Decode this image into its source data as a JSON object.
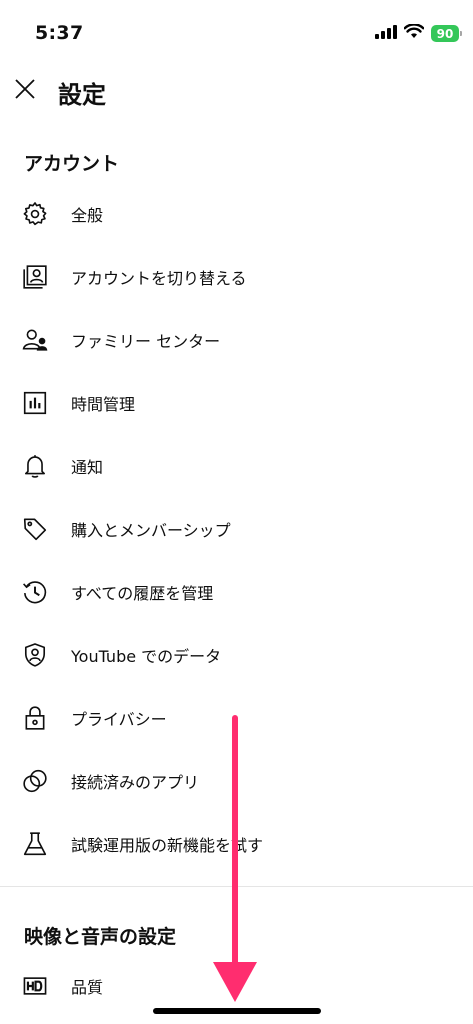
{
  "status_bar": {
    "time": "5:37",
    "battery": "90"
  },
  "header": {
    "title": "設定"
  },
  "sections": [
    {
      "heading": "アカウント"
    },
    {
      "heading": "映像と音声の設定"
    }
  ],
  "items": [
    {
      "label": "全般",
      "icon": "gear-icon"
    },
    {
      "label": "アカウントを切り替える",
      "icon": "switch-account-icon"
    },
    {
      "label": "ファミリー センター",
      "icon": "family-center-icon"
    },
    {
      "label": "時間管理",
      "icon": "time-management-icon"
    },
    {
      "label": "通知",
      "icon": "bell-icon"
    },
    {
      "label": "購入とメンバーシップ",
      "icon": "tag-icon"
    },
    {
      "label": "すべての履歴を管理",
      "icon": "history-icon"
    },
    {
      "label": "YouTube でのデータ",
      "icon": "shield-person-icon"
    },
    {
      "label": "プライバシー",
      "icon": "lock-icon"
    },
    {
      "label": "接続済みのアプリ",
      "icon": "connected-apps-icon"
    },
    {
      "label": "試験運用版の新機能を試す",
      "icon": "flask-icon"
    },
    {
      "label": "品質",
      "icon": "hd-icon"
    }
  ],
  "annotation": {
    "color": "#ff2d6f",
    "direction": "down"
  }
}
